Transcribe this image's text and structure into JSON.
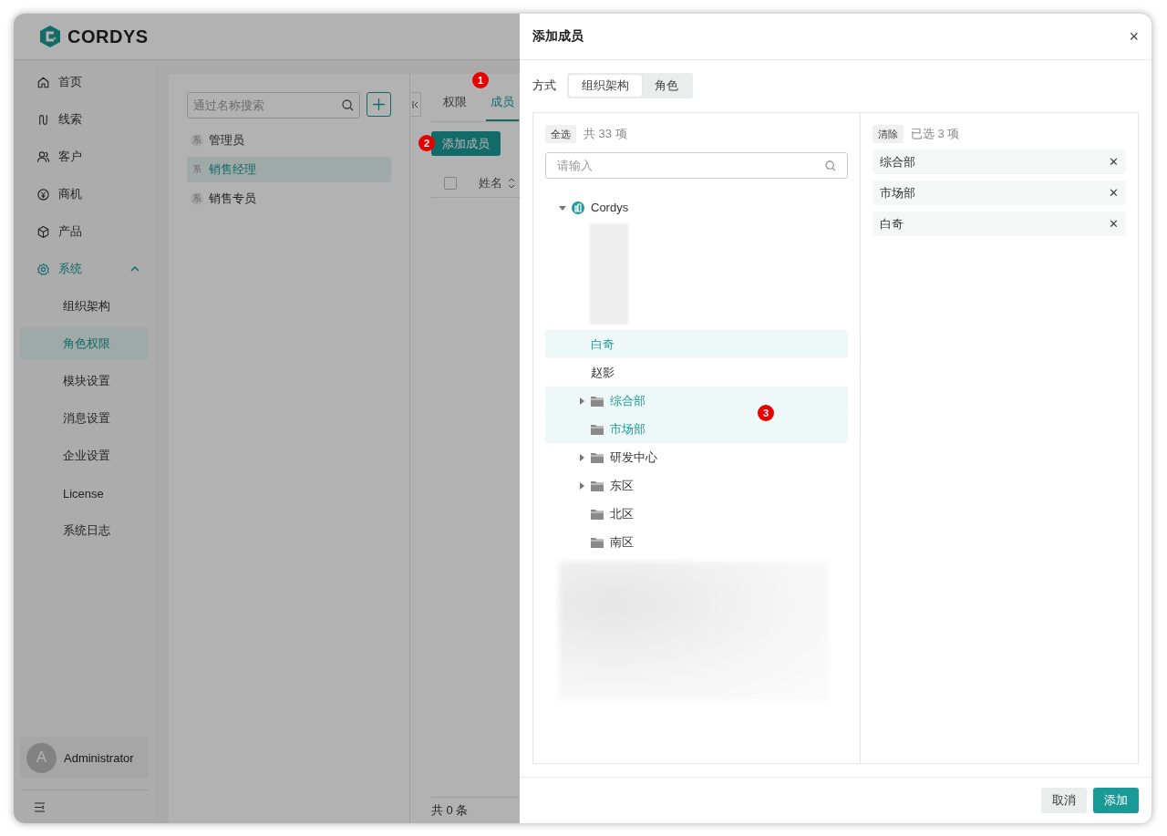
{
  "app": {
    "logo": "CORDYS",
    "sidebar": {
      "items": [
        {
          "label": "首页"
        },
        {
          "label": "线索"
        },
        {
          "label": "客户"
        },
        {
          "label": "商机"
        },
        {
          "label": "产品"
        },
        {
          "label": "系统",
          "expanded": true,
          "children": [
            {
              "label": "组织架构",
              "selected": false
            },
            {
              "label": "角色权限",
              "selected": true
            },
            {
              "label": "模块设置",
              "selected": false
            },
            {
              "label": "消息设置",
              "selected": false
            },
            {
              "label": "企业设置",
              "selected": false
            },
            {
              "label": "License",
              "selected": false
            },
            {
              "label": "系统日志",
              "selected": false
            }
          ]
        }
      ],
      "user": {
        "initial": "A",
        "name": "Administrator"
      }
    },
    "roles": {
      "search_placeholder": "通过名称搜索",
      "items": [
        {
          "tag": "系",
          "label": "管理员",
          "selected": false
        },
        {
          "tag": "系",
          "label": "销售经理",
          "selected": true
        },
        {
          "tag": "系",
          "label": "销售专员",
          "selected": false
        }
      ]
    },
    "tabs": [
      {
        "label": "权限",
        "selected": false
      },
      {
        "label": "成员",
        "selected": true
      }
    ],
    "add_button": "添加成员",
    "table": {
      "checked": false,
      "columns": [
        "姓名"
      ]
    },
    "footer": "共 0 条"
  },
  "callouts": [
    "1",
    "2",
    "3"
  ],
  "drawer": {
    "title": "添加成员",
    "close": "×",
    "mode_label": "方式",
    "modes": [
      {
        "label": "组织架构",
        "selected": true
      },
      {
        "label": "角色",
        "selected": false
      }
    ],
    "left": {
      "select_all": "全选",
      "count": "共 33 项",
      "placeholder": "请输入",
      "tree": [
        {
          "label": "Cordys",
          "kind": "org",
          "expanded": true,
          "selected": false,
          "children": [
            {
              "kind": "blurred"
            },
            {
              "label": "白奇",
              "kind": "user",
              "selected": true
            },
            {
              "label": "赵影",
              "kind": "user",
              "selected": false
            },
            {
              "label": "综合部",
              "kind": "folder",
              "expanded": false,
              "selected": true
            },
            {
              "label": "市场部",
              "kind": "folder",
              "selected": true
            },
            {
              "label": "研发中心",
              "kind": "folder",
              "expanded": false,
              "selected": false
            },
            {
              "label": "东区",
              "kind": "folder",
              "expanded": false,
              "selected": false
            },
            {
              "label": "北区",
              "kind": "folder",
              "selected": false
            },
            {
              "label": "南区",
              "kind": "folder",
              "selected": false
            },
            {
              "kind": "blurred_large"
            }
          ]
        }
      ]
    },
    "right": {
      "clear": "清除",
      "count": "已选 3 项",
      "items": [
        "综合部",
        "市场部",
        "白奇"
      ],
      "remove": "✕"
    },
    "buttons": [
      {
        "label": "取消",
        "kind": "secondary"
      },
      {
        "label": "添加",
        "kind": "primary"
      }
    ]
  }
}
